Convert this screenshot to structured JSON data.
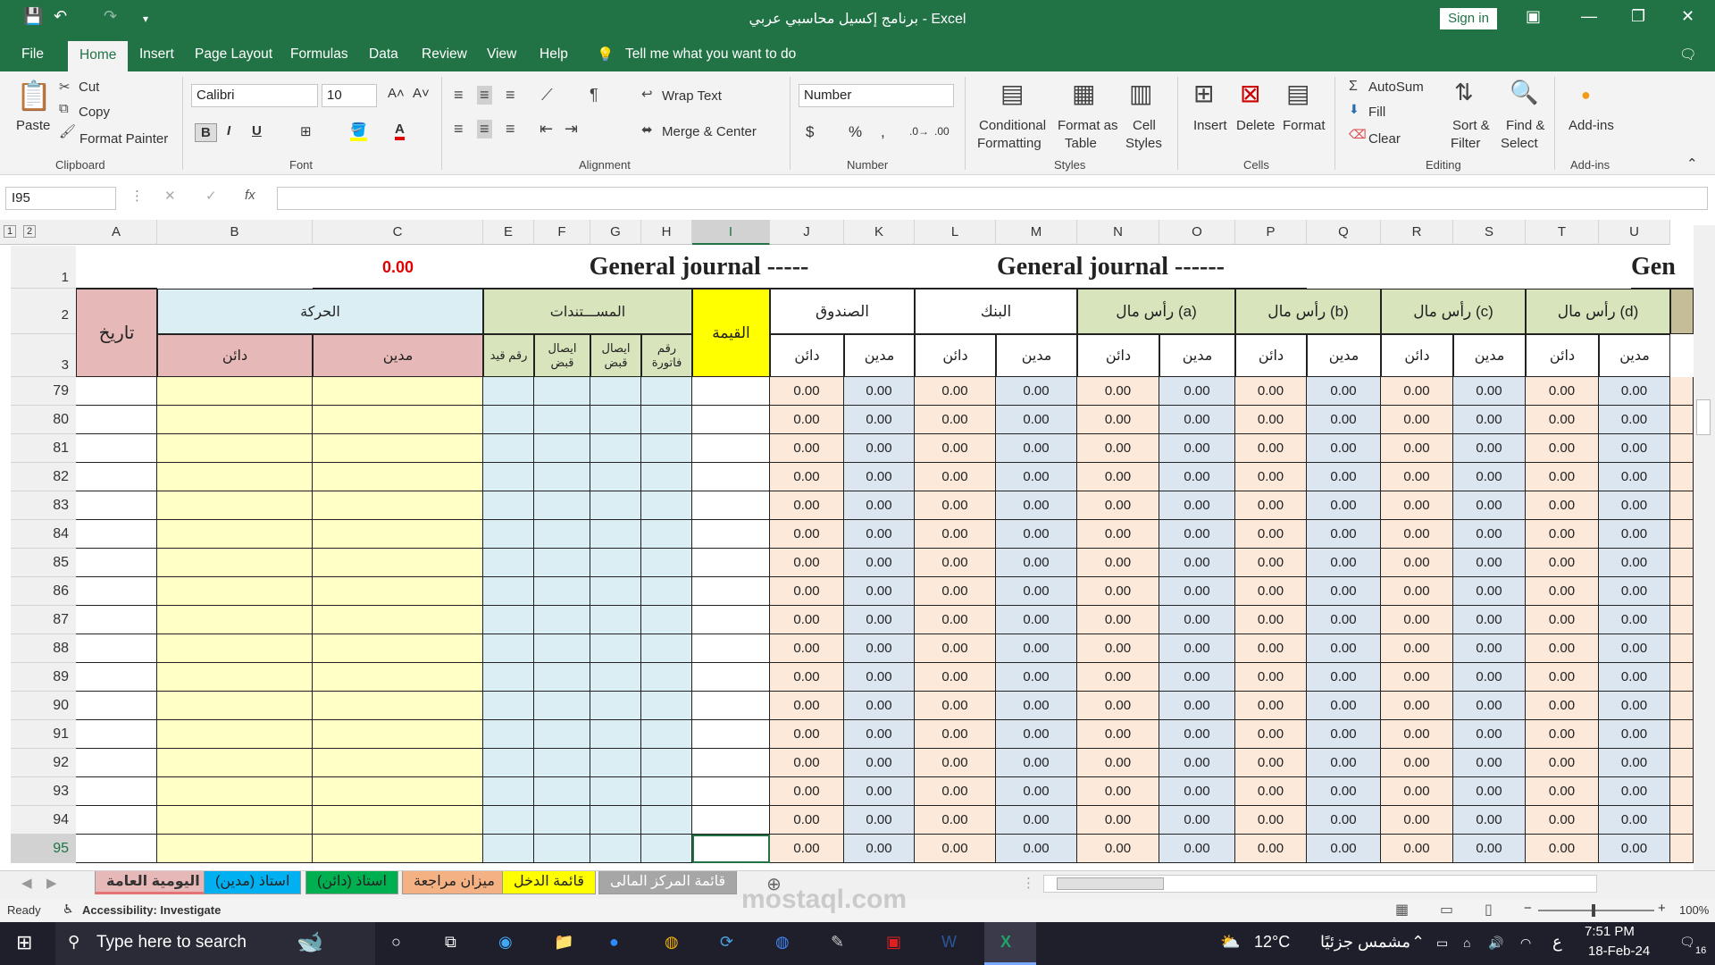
{
  "title": "برنامج إكسيل محاسبي عربي  -  Excel",
  "signin": "Sign in",
  "menu": [
    "File",
    "Home",
    "Insert",
    "Page Layout",
    "Formulas",
    "Data",
    "Review",
    "View",
    "Help",
    "Tell me what you want to do"
  ],
  "ribbon": {
    "paste": "Paste",
    "cut": "Cut",
    "copy": "Copy",
    "format_painter": "Format Painter",
    "clipboard": "Clipboard",
    "font_name": "Calibri",
    "font_size": "10",
    "font": "Font",
    "bold": "B",
    "italic": "I",
    "underline": "U",
    "wrap_text": "Wrap Text",
    "merge_center": "Merge & Center",
    "alignment": "Alignment",
    "number_format": "Number",
    "number": "Number",
    "currency": "$",
    "percent": "%",
    "comma": ",",
    "conditional": "Conditional",
    "formatting": "Formatting",
    "format_as": "Format as",
    "table": "Table",
    "cell": "Cell",
    "styles_btn": "Styles",
    "styles": "Styles",
    "insert": "Insert",
    "delete": "Delete",
    "format": "Format",
    "cells": "Cells",
    "autosum": "AutoSum",
    "fill": "Fill",
    "clear": "Clear",
    "sort": "Sort &",
    "filter": "Filter",
    "find": "Find &",
    "select": "Select",
    "editing": "Editing",
    "addins": "Add-ins",
    "addins_group": "Add-ins"
  },
  "name_box": "I95",
  "fx": "fx",
  "columns": [
    "A",
    "B",
    "C",
    "E",
    "F",
    "G",
    "H",
    "I",
    "J",
    "K",
    "L",
    "M",
    "N",
    "O",
    "P",
    "Q",
    "R",
    "S",
    "T",
    "U"
  ],
  "row1": {
    "value": "0.00",
    "title1": "General journal -----",
    "title2": "General journal   ------",
    "title3": "Gen"
  },
  "headers": {
    "date": "تاريخ",
    "movement": "الحركة",
    "credit": "دائن",
    "debit": "مدين",
    "docs": "المســـتندات",
    "entry_no": "رقم قيد",
    "receipt1": "ايصال قبض",
    "receipt2": "ايصال قبض",
    "invoice": "رقم فاتورة",
    "amount": "القيمة",
    "accounts": [
      "الصندوق",
      "البنك",
      "رأس مال (a)",
      "رأس مال (b)",
      "رأس مال (c)",
      "رأس مال (d)"
    ]
  },
  "rows": [
    "79",
    "80",
    "81",
    "82",
    "83",
    "84",
    "85",
    "86",
    "87",
    "88",
    "89",
    "90",
    "91",
    "92",
    "93",
    "94",
    "95"
  ],
  "zero": "0.00",
  "sheets": [
    "اليومية العامة",
    "استاذ (مدين)",
    "استاذ (دائن)",
    "ميزان مراجعة",
    "قائمة الدخل",
    "قائمة المركز المالى"
  ],
  "status": {
    "ready": "Ready",
    "accessibility": "Accessibility: Investigate",
    "zoom": "100%"
  },
  "taskbar": {
    "search": "Type here to search",
    "temp": "12°C",
    "weather": "مشمس جزئيًا",
    "lang": "ع",
    "time": "7:51 PM",
    "date": "18-Feb-24",
    "notif": "16"
  },
  "watermark": "mostaql.com",
  "colors": {
    "excel_green": "#217346",
    "yellow": "#ffffc6",
    "pink": "#e6b8b7",
    "peach": "#fde9d9",
    "blue": "#dce6f1",
    "lightblue": "#daeef3",
    "green": "#d8e4bc"
  }
}
